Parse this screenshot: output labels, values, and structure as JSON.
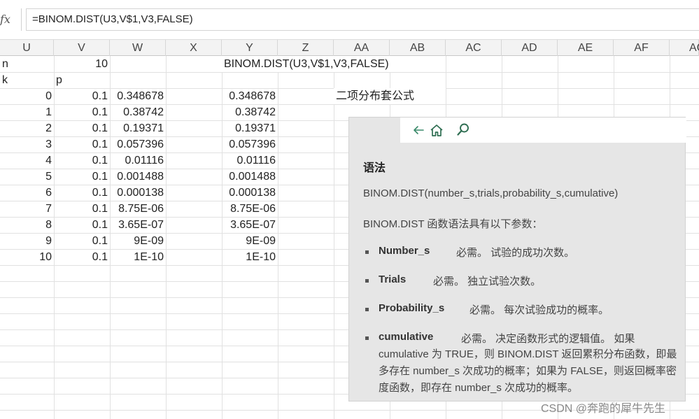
{
  "formula_bar": {
    "fx": "fx",
    "formula": "=BINOM.DIST(U3,V$1,V3,FALSE)"
  },
  "columns": [
    "U",
    "V",
    "W",
    "X",
    "Y",
    "Z",
    "AA",
    "AB",
    "AC",
    "AD",
    "AE",
    "AF",
    "AG"
  ],
  "row1": {
    "label": "n",
    "n_value": "10",
    "formula_text": "BINOM.DIST(U3,V$1,V3,FALSE)"
  },
  "row2": {
    "label_k": "k",
    "label_p": "p"
  },
  "note": "二项分布套公式",
  "rows": [
    {
      "k": "0",
      "p": "0.1",
      "w": "0.348678",
      "y": "0.348678"
    },
    {
      "k": "1",
      "p": "0.1",
      "w": "0.38742",
      "y": "0.38742"
    },
    {
      "k": "2",
      "p": "0.1",
      "w": "0.19371",
      "y": "0.19371"
    },
    {
      "k": "3",
      "p": "0.1",
      "w": "0.057396",
      "y": "0.057396"
    },
    {
      "k": "4",
      "p": "0.1",
      "w": "0.01116",
      "y": "0.01116"
    },
    {
      "k": "5",
      "p": "0.1",
      "w": "0.001488",
      "y": "0.001488"
    },
    {
      "k": "6",
      "p": "0.1",
      "w": "0.000138",
      "y": "0.000138"
    },
    {
      "k": "7",
      "p": "0.1",
      "w": "8.75E-06",
      "y": "8.75E-06"
    },
    {
      "k": "8",
      "p": "0.1",
      "w": "3.65E-07",
      "y": "3.65E-07"
    },
    {
      "k": "9",
      "p": "0.1",
      "w": "9E-09",
      "y": "9E-09"
    },
    {
      "k": "10",
      "p": "0.1",
      "w": "1E-10",
      "y": "1E-10"
    }
  ],
  "help": {
    "title": "语法",
    "syntax": "BINOM.DIST(number_s,trials,probability_s,cumulative)",
    "intro": "BINOM.DIST 函数语法具有以下参数：",
    "params": [
      {
        "term": "Number_s",
        "desc": "必需。 试验的成功次数。"
      },
      {
        "term": "Trials",
        "desc": "必需。 独立试验次数。"
      },
      {
        "term": "Probability_s",
        "desc": "必需。 每次试验成功的概率。"
      },
      {
        "term": "cumulative",
        "desc": "必需。 决定函数形式的逻辑值。 如果"
      }
    ],
    "cumulative_more": "cumulative 为 TRUE，则 BINOM.DIST 返回累积分布函数，即最多存在 number_s 次成功的概率；如果为 FALSE，则返回概率密度函数，即存在 number_s 次成功的概率。"
  },
  "watermark": "CSDN @奔跑的犀牛先生",
  "colors": {
    "pane_bg": "#e6e6e6",
    "header_bg": "#f3f3f3",
    "gridline": "#e1e1e1"
  }
}
